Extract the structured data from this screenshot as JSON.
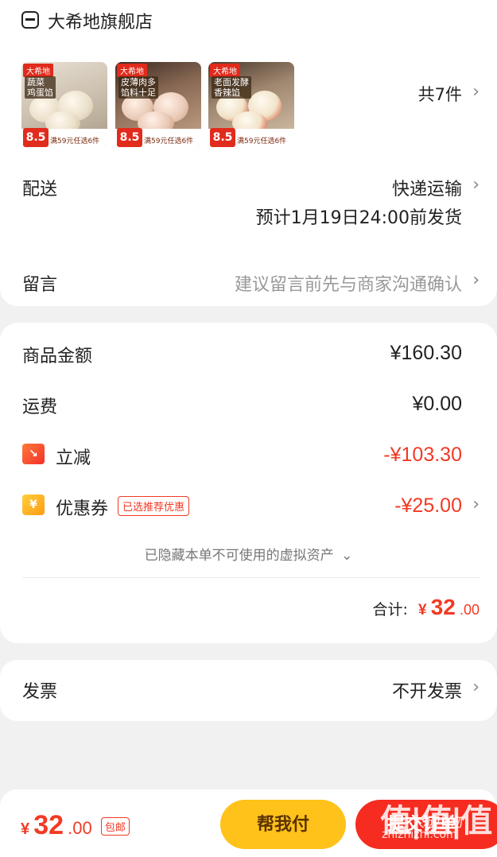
{
  "store": {
    "name": "大希地旗舰店",
    "icon": "store-icon"
  },
  "products": [
    {
      "brand": "大希地",
      "name": "蔬菜\n鸡蛋馅",
      "price": "8.5",
      "promo": "满59元任选6件"
    },
    {
      "brand": "大希地",
      "name": "皮薄肉多\n馅料十足",
      "price": "8.5",
      "promo": "满59元任选6件"
    },
    {
      "brand": "大希地",
      "name": "老面发酵\n香辣馅",
      "price": "8.5",
      "promo": "满59元任选6件"
    }
  ],
  "item_count": "共7件",
  "delivery": {
    "label": "配送",
    "method": "快递运输",
    "estimate": "预计1月19日24:00前发货"
  },
  "message": {
    "label": "留言",
    "placeholder": "建议留言前先与商家沟通确认"
  },
  "summary": {
    "goods_label": "商品金额",
    "goods_value": "¥160.30",
    "shipping_label": "运费",
    "shipping_value": "¥0.00",
    "discount_label": "立减",
    "discount_value": "-¥103.30",
    "coupon_label": "优惠券",
    "coupon_tag": "已选推荐优惠",
    "coupon_value": "-¥25.00",
    "hidden_assets": "已隐藏本单不可使用的虚拟资产",
    "total_label": "合计:",
    "total_currency": "¥",
    "total_int": "32",
    "total_dec": ".00"
  },
  "invoice": {
    "label": "发票",
    "value": "不开发票"
  },
  "bottom": {
    "currency": "¥",
    "amount_int": "32",
    "amount_dec": ".00",
    "free_shipping": "包邮",
    "help_pay": "帮我付",
    "submit": "提交订单"
  },
  "watermark": {
    "main": "值|值|值",
    "sub": "zhizhizhi.com",
    "extra": "大城小物"
  },
  "colors": {
    "accent_red": "#f23a24",
    "help_pay_yellow": "#ffc21a",
    "submit_red": "#f52c1f"
  }
}
